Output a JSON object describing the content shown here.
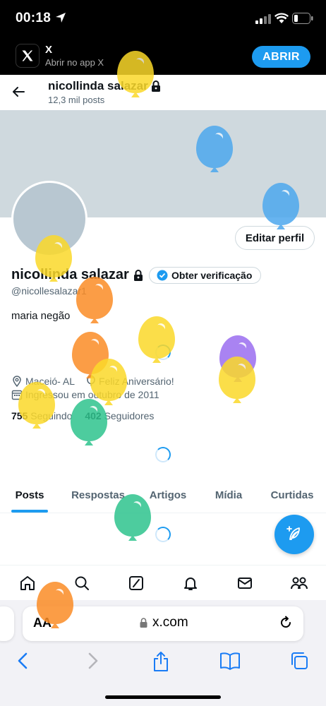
{
  "status_bar": {
    "time": "00:18"
  },
  "app_banner": {
    "name": "X",
    "subtitle": "Abrir no app X",
    "open_label": "ABRIR"
  },
  "header": {
    "title": "nicollinda salazar",
    "post_count": "12,3 mil posts"
  },
  "profile": {
    "edit_label": "Editar perfil",
    "name": "nicollinda salazar",
    "verify_label": "Obter verificação",
    "handle": "@nicollesalazar1",
    "bio": "maria negão",
    "location": "Maceió- AL",
    "birthday": "Feliz Aniversário!",
    "joined": "Ingressou em outubro de 2011",
    "following_count": "755",
    "following_label": "Seguindo",
    "followers_count": "402",
    "followers_label": "Seguidores"
  },
  "tabs": [
    {
      "label": "Posts"
    },
    {
      "label": "Respostas"
    },
    {
      "label": "Artigos"
    },
    {
      "label": "Mídia"
    },
    {
      "label": "Curtidas"
    }
  ],
  "bottom_nav": [
    "home-icon",
    "search-icon",
    "grok-icon",
    "bell-icon",
    "mail-icon",
    "communities-icon"
  ],
  "safari": {
    "aa_label": "AA",
    "url": "x.com"
  },
  "colors": {
    "accent": "#1d9bf0",
    "cover": "#cfd9de"
  }
}
